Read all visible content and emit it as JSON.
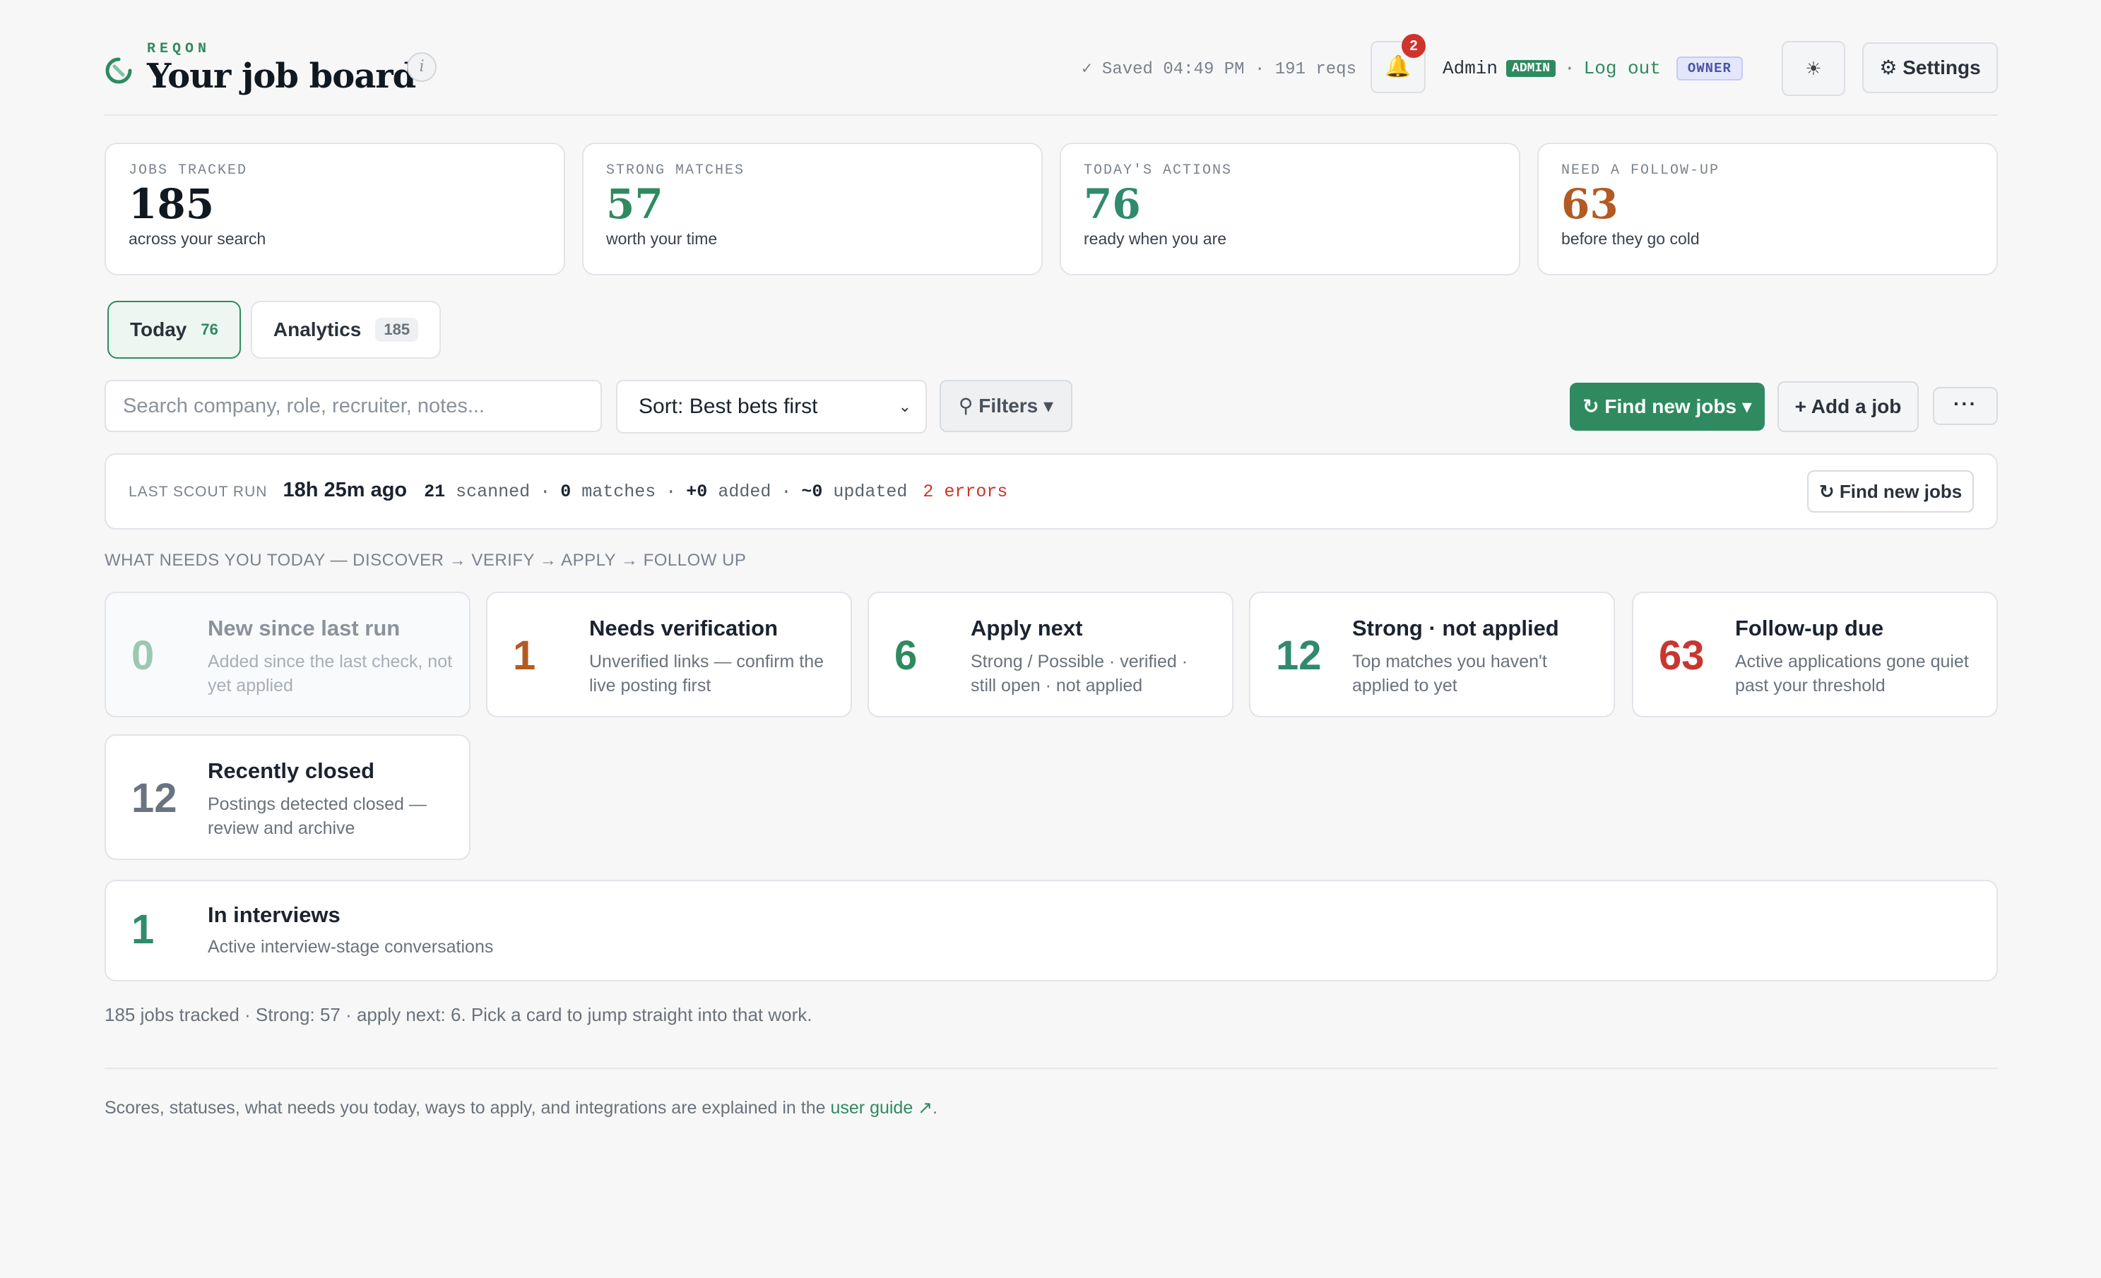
{
  "header": {
    "brand_name": "REQON",
    "title": "Your job board",
    "info_label": "i",
    "save_status": "✓ Saved 04:49 PM · 191 reqs",
    "notifications_count": "2",
    "user_name": "Admin",
    "role_badge": "ADMIN",
    "separator": "·",
    "logout_label": "Log out",
    "owner_badge": "OWNER",
    "theme_icon": "☀",
    "settings_label": "⚙ Settings"
  },
  "stats": [
    {
      "label": "JOBS TRACKED",
      "value": "185",
      "sub": "across your search",
      "color": "#101820"
    },
    {
      "label": "STRONG MATCHES",
      "value": "57",
      "sub": "worth your time",
      "color": "#2f8a5f"
    },
    {
      "label": "TODAY'S ACTIONS",
      "value": "76",
      "sub": "ready when you are",
      "color": "#2f8a6e"
    },
    {
      "label": "NEED A FOLLOW-UP",
      "value": "63",
      "sub": "before they go cold",
      "color": "#b35a22"
    }
  ],
  "tabs": [
    {
      "label": "Today",
      "count": "76",
      "active": true
    },
    {
      "label": "Analytics",
      "count": "185",
      "active": false
    }
  ],
  "toolbar": {
    "search_placeholder": "Search company, role, recruiter, notes...",
    "sort_value": "Sort: Best bets first",
    "filters_label": "⚲ Filters ▾",
    "find_label": "↻ Find new jobs ▾",
    "add_label": "+ Add a job",
    "more_label": "···"
  },
  "scout": {
    "label": "LAST SCOUT RUN",
    "ago": "18h 25m ago",
    "scanned_n": "21",
    "scanned_l": "scanned",
    "matches_n": "0",
    "matches_l": "matches",
    "added_n": "+0",
    "added_l": "added",
    "updated_n": "~0",
    "updated_l": "updated",
    "sep": "·",
    "errors": "2 errors",
    "find_label": "↻ Find new jobs"
  },
  "section_heading": "WHAT NEEDS YOU TODAY — DISCOVER → VERIFY → APPLY → FOLLOW UP",
  "cards": [
    {
      "num": "0",
      "title": "New since last run",
      "desc": "Added since the last check, not yet applied",
      "color": "#9cc7b3"
    },
    {
      "num": "1",
      "title": "Needs verification",
      "desc": "Unverified links — confirm the live posting first",
      "color": "#b35a22"
    },
    {
      "num": "6",
      "title": "Apply next",
      "desc": "Strong / Possible · verified · still open · not applied",
      "color": "#2f8a5f"
    },
    {
      "num": "12",
      "title": "Strong · not applied",
      "desc": "Top matches you haven't applied to yet",
      "color": "#2f8a6e"
    },
    {
      "num": "63",
      "title": "Follow-up due",
      "desc": "Active applications gone quiet past your threshold",
      "color": "#c8372f"
    },
    {
      "num": "12",
      "title": "Recently closed",
      "desc": "Postings detected closed — review and archive",
      "color": "#6a7480"
    }
  ],
  "interviews": {
    "num": "1",
    "title": "In interviews",
    "desc": "Active interview-stage conversations",
    "color": "#2f8a6e"
  },
  "summary": "185 jobs tracked · Strong: 57 · apply next: 6. Pick a card to jump straight into that work.",
  "footer": {
    "text": "Scores, statuses, what needs you today, ways to apply, and integrations are explained in the",
    "link": "user guide ↗",
    "end": "."
  },
  "colors": {
    "accent": "#2f8a5f",
    "error": "#d0332c",
    "warning": "#b35a22"
  }
}
